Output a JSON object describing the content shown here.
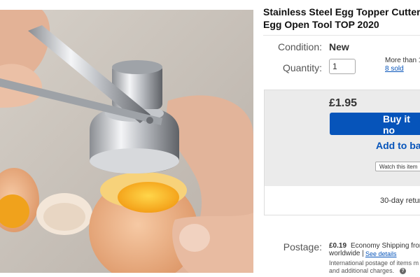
{
  "product": {
    "title_line1": "Stainless Steel Egg Topper Cutter S",
    "title_line2": "Egg Open Tool TOP 2020"
  },
  "details": {
    "condition_label": "Condition:",
    "condition_value": "New",
    "quantity_label": "Quantity:",
    "quantity_value": "1",
    "availability": "More than 1",
    "sold": "8 sold"
  },
  "purchase": {
    "price": "£1.95",
    "buy_label": "Buy it no",
    "basket_label": "Add to bas",
    "watch_label": "Watch this item",
    "returns": "30-day retur"
  },
  "postage": {
    "label": "Postage:",
    "price": "£0.19",
    "service": "Economy Shipping from",
    "region": "worldwide |",
    "see_details": "See details",
    "intl_line1": "International postage of items m",
    "intl_line2": "and additional charges."
  },
  "icons": {
    "help": "question-circle-icon"
  },
  "colors": {
    "accent": "#0654ba",
    "buybox_bg": "#ebebeb"
  }
}
